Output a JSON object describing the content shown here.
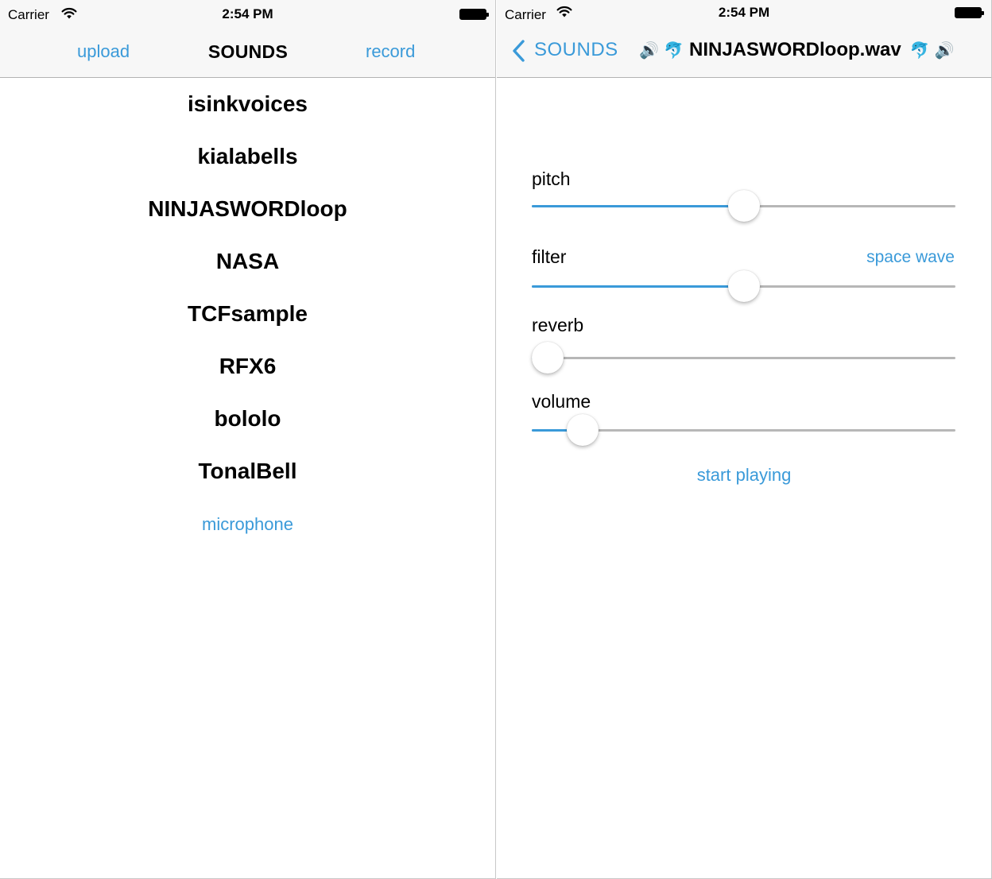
{
  "left": {
    "status": {
      "carrier": "Carrier",
      "time": "2:54 PM"
    },
    "nav": {
      "left_label": "upload",
      "title": "SOUNDS",
      "right_label": "record"
    },
    "sounds": [
      "isinkvoices",
      "kialabells",
      "NINJASWORDloop",
      "NASA",
      "TCFsample",
      "RFX6",
      "bololo",
      "TonalBell"
    ],
    "microphone_label": "microphone"
  },
  "right": {
    "status": {
      "carrier": "Carrier",
      "time": "2:54 PM"
    },
    "nav": {
      "back_label": "SOUNDS",
      "title": "NINJASWORDloop.wav",
      "emoji_speaker": "🔊",
      "emoji_dolphin": "🐬"
    },
    "controls": [
      {
        "label": "pitch",
        "value_label": "",
        "level": 0.5
      },
      {
        "label": "filter",
        "value_label": "space wave",
        "level": 0.5
      },
      {
        "label": "reverb",
        "value_label": "",
        "level": 0.0
      },
      {
        "label": "volume",
        "value_label": "",
        "level": 0.09
      }
    ],
    "play_label": "start playing"
  },
  "colors": {
    "accent": "#3a9ad9",
    "track": "#b7b7b7",
    "navbar": "#f7f7f7"
  },
  "icons": {
    "wifi": "wifi-icon",
    "battery": "battery-icon",
    "back": "chevron-left-icon",
    "speaker": "speaker-icon",
    "dolphin": "dolphin-icon"
  }
}
